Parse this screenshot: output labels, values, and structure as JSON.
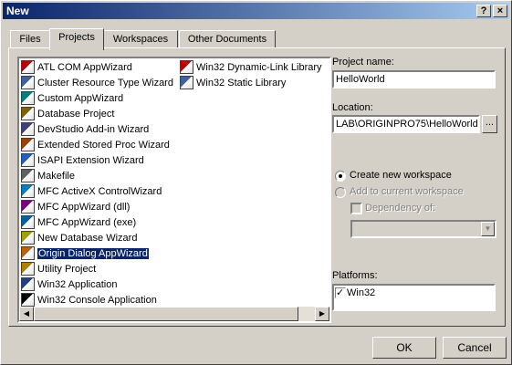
{
  "window": {
    "title": "New",
    "help_glyph": "?",
    "close_glyph": "×"
  },
  "tabs": [
    "Files",
    "Projects",
    "Workspaces",
    "Other Documents"
  ],
  "active_tab": "Projects",
  "projects_col1": [
    {
      "label": "ATL COM AppWizard",
      "icon": "atl-icon"
    },
    {
      "label": "Cluster Resource Type Wizard",
      "icon": "cluster-icon"
    },
    {
      "label": "Custom AppWizard",
      "icon": "custom-wizard-icon"
    },
    {
      "label": "Database Project",
      "icon": "database-icon"
    },
    {
      "label": "DevStudio Add-in Wizard",
      "icon": "addin-icon"
    },
    {
      "label": "Extended Stored Proc Wizard",
      "icon": "stored-proc-icon"
    },
    {
      "label": "ISAPI Extension Wizard",
      "icon": "isapi-icon"
    },
    {
      "label": "Makefile",
      "icon": "makefile-icon"
    },
    {
      "label": "MFC ActiveX ControlWizard",
      "icon": "activex-icon"
    },
    {
      "label": "MFC AppWizard (dll)",
      "icon": "mfc-dll-icon"
    },
    {
      "label": "MFC AppWizard (exe)",
      "icon": "mfc-exe-icon"
    },
    {
      "label": "New Database Wizard",
      "icon": "new-db-icon"
    },
    {
      "label": "Origin Dialog AppWizard",
      "icon": "origin-icon",
      "selected": true
    },
    {
      "label": "Utility Project",
      "icon": "utility-icon"
    },
    {
      "label": "Win32 Application",
      "icon": "win32-app-icon"
    },
    {
      "label": "Win32 Console Application",
      "icon": "console-icon"
    }
  ],
  "projects_col2": [
    {
      "label": "Win32 Dynamic-Link Library",
      "icon": "dll-icon"
    },
    {
      "label": "Win32 Static Library",
      "icon": "static-lib-icon"
    }
  ],
  "form": {
    "project_name_label": "Project name:",
    "project_name_value": "HelloWorld",
    "location_label": "Location:",
    "location_value": "LAB\\ORIGINPRO75\\HelloWorld",
    "browse_label": "...",
    "create_new_label": "Create new workspace",
    "add_current_label": "Add to current workspace",
    "dependency_label": "Dependency of:",
    "platforms_label": "Platforms:",
    "platform_item": "Win32"
  },
  "buttons": {
    "ok": "OK",
    "cancel": "Cancel"
  },
  "colors": {
    "title_start": "#0a246a",
    "title_end": "#a6caf0",
    "face": "#d4d0c8",
    "selection": "#0a246a"
  }
}
